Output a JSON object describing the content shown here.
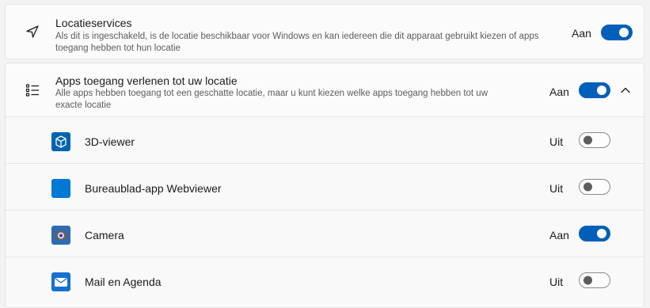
{
  "location_services": {
    "title": "Locatieservices",
    "description": "Als dit is ingeschakeld, is de locatie beschikbaar voor Windows en kan iedereen die dit apparaat gebruikt kiezen of apps toegang hebben tot hun locatie",
    "state_label": "Aan",
    "on": true,
    "icon": "navigation-arrow-icon"
  },
  "app_access": {
    "title": "Apps toegang verlenen tot uw locatie",
    "description": "Alle apps hebben toegang tot een geschatte locatie, maar u kunt kiezen welke apps toegang hebben tot uw exacte locatie",
    "state_label": "Aan",
    "on": true,
    "icon": "list-icon",
    "expanded": true
  },
  "apps": [
    {
      "name": "3D-viewer",
      "state_label": "Uit",
      "on": false,
      "icon": "3d-cube-icon",
      "icon_color": "#0063b1"
    },
    {
      "name": "Bureaublad-app Webviewer",
      "state_label": "Uit",
      "on": false,
      "icon": "webviewer-icon",
      "icon_color": "#0078d4"
    },
    {
      "name": "Camera",
      "state_label": "Aan",
      "on": true,
      "icon": "camera-icon",
      "icon_color": "#2b6cb5"
    },
    {
      "name": "Mail en Agenda",
      "state_label": "Uit",
      "on": false,
      "icon": "mail-icon",
      "icon_color": "#1570d0"
    }
  ],
  "colors": {
    "accent": "#005fb8",
    "card_bg": "#fbfbfb",
    "page_bg": "#f3f3f3"
  }
}
